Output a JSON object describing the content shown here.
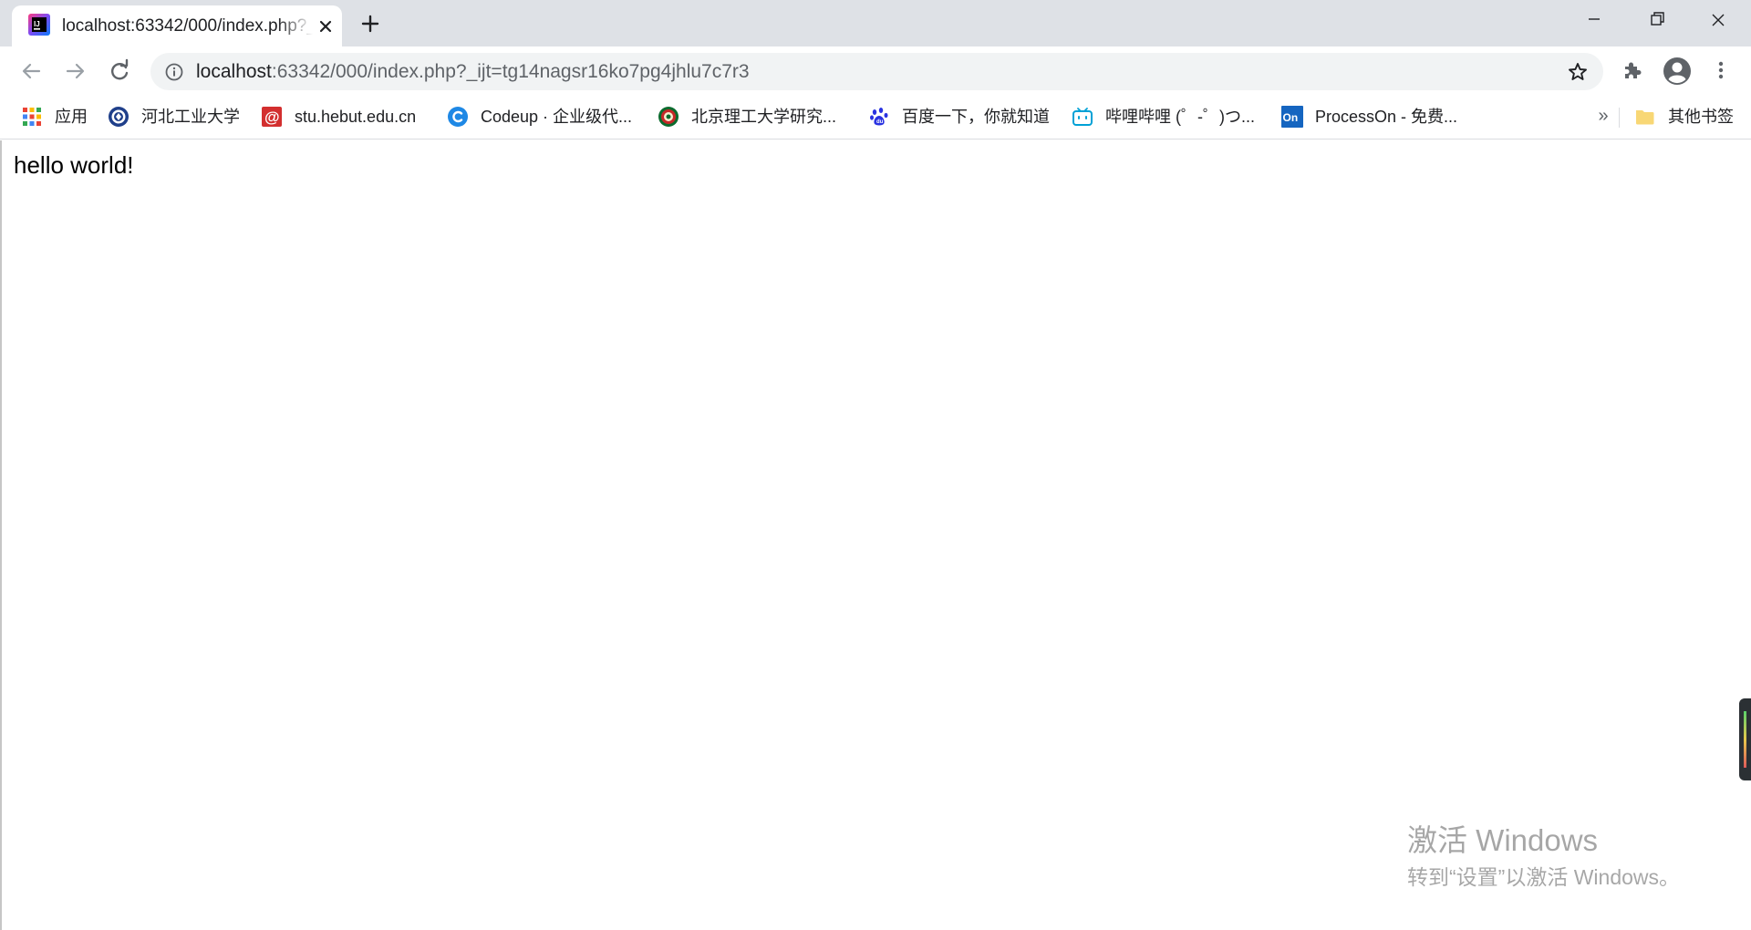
{
  "tab": {
    "title": "localhost:63342/000/index.php?_ijt=tg14nagsr16ko7pg4jhlu7c7r3",
    "favicon": "jetbrains-icon"
  },
  "toolbar": {
    "url_host": "localhost",
    "url_rest": ":63342/000/index.php?_ijt=tg14nagsr16ko7pg4jhlu7c7r3"
  },
  "bookmarks": [
    {
      "label": "应用",
      "icon": "apps-grid-icon"
    },
    {
      "label": "河北工业大学",
      "icon": "hebut-emblem-icon"
    },
    {
      "label": "stu.hebut.edu.cn",
      "icon": "at-sign-icon"
    },
    {
      "label": "Codeup · 企业级代...",
      "icon": "codeup-icon"
    },
    {
      "label": "北京理工大学研究...",
      "icon": "bit-emblem-icon"
    },
    {
      "label": "百度一下，你就知道",
      "icon": "baidu-paw-icon"
    },
    {
      "label": "哔哩哔哩 (゜-゜)つ...",
      "icon": "bilibili-tv-icon"
    },
    {
      "label": "ProcessOn - 免费...",
      "icon": "processon-icon"
    },
    {
      "label": "其他书签",
      "icon": "folder-icon"
    }
  ],
  "page": {
    "text": "hello world!"
  },
  "watermark": {
    "line1": "激活 Windows",
    "line2": "转到“设置”以激活 Windows。"
  },
  "colors": {
    "tabstrip_bg": "#dee1e6",
    "omnibox_bg": "#f1f3f4",
    "chrome_icon": "#5f6368",
    "link_blue": "#1a73e8"
  }
}
